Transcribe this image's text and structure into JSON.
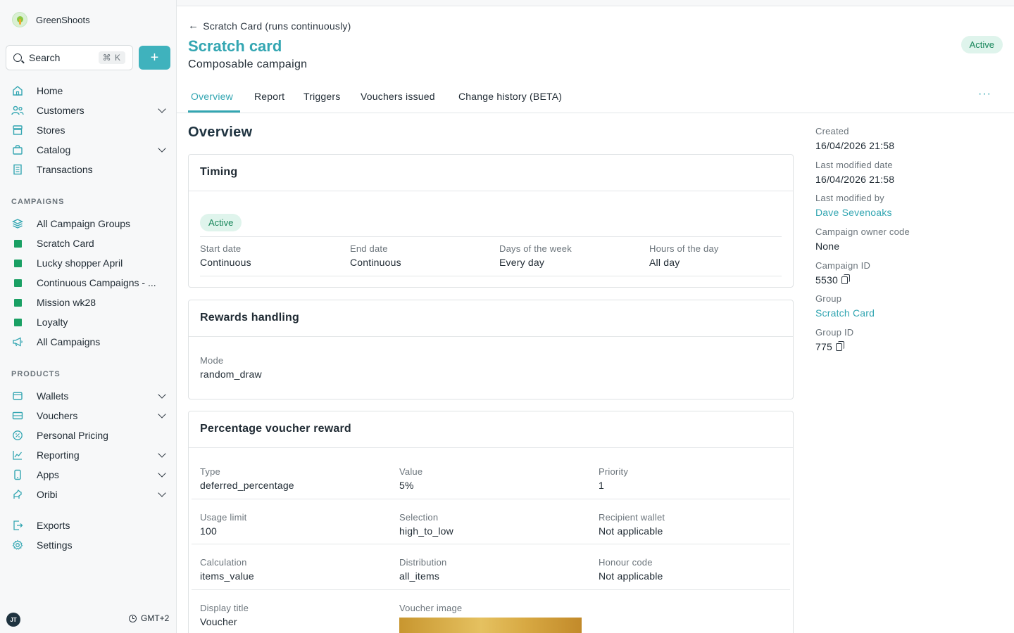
{
  "brand": {
    "name": "GreenShoots"
  },
  "search": {
    "label": "Search",
    "shortcut": "⌘ K"
  },
  "nav": {
    "home": "Home",
    "customers": "Customers",
    "stores": "Stores",
    "catalog": "Catalog",
    "transactions": "Transactions"
  },
  "campaigns_section": {
    "title": "CAMPAIGNS",
    "items": [
      "All Campaign Groups",
      "Scratch Card",
      "Lucky shopper April",
      "Continuous Campaigns - ...",
      "Mission wk28",
      "Loyalty",
      "All Campaigns"
    ]
  },
  "products_section": {
    "title": "PRODUCTS",
    "items": [
      "Wallets",
      "Vouchers",
      "Personal Pricing",
      "Reporting",
      "Apps",
      "Oribi"
    ]
  },
  "bottom_nav": {
    "exports": "Exports",
    "settings": "Settings"
  },
  "footer": {
    "avatar_initials": "JT",
    "timezone": "GMT+2"
  },
  "header": {
    "back_label": "Scratch Card (runs continuously)",
    "title": "Scratch card",
    "subtitle": "Composable campaign",
    "status": "Active"
  },
  "tabs": [
    "Overview",
    "Report",
    "Triggers",
    "Vouchers issued",
    "Change history (BETA)"
  ],
  "more_label": "···",
  "overview": {
    "title": "Overview",
    "timing": {
      "title": "Timing",
      "status": "Active",
      "fields": [
        {
          "label": "Start date",
          "value": "Continuous"
        },
        {
          "label": "End date",
          "value": "Continuous"
        },
        {
          "label": "Days of the week",
          "value": "Every day"
        },
        {
          "label": "Hours of the day",
          "value": "All day"
        }
      ]
    },
    "rewards": {
      "title": "Rewards handling",
      "mode_label": "Mode",
      "mode_value": "random_draw"
    },
    "voucher_reward": {
      "title": "Percentage voucher reward",
      "rows": [
        [
          {
            "label": "Type",
            "value": "deferred_percentage"
          },
          {
            "label": "Value",
            "value": "5%"
          },
          {
            "label": "Priority",
            "value": "1"
          }
        ],
        [
          {
            "label": "Usage limit",
            "value": "100"
          },
          {
            "label": "Selection",
            "value": "high_to_low"
          },
          {
            "label": "Recipient wallet",
            "value": "Not applicable"
          }
        ],
        [
          {
            "label": "Calculation",
            "value": "items_value"
          },
          {
            "label": "Distribution",
            "value": "all_items"
          },
          {
            "label": "Honour code",
            "value": "Not applicable"
          }
        ]
      ],
      "display_title_label": "Display title",
      "display_title_value": "Voucher",
      "voucher_image_label": "Voucher image"
    }
  },
  "meta": {
    "created_label": "Created",
    "created_value": "16/04/2026 21:58",
    "modified_label": "Last modified date",
    "modified_value": "16/04/2026 21:58",
    "modified_by_label": "Last modified by",
    "modified_by_value": "Dave Sevenoaks",
    "owner_label": "Campaign owner code",
    "owner_value": "None",
    "campaign_id_label": "Campaign ID",
    "campaign_id_value": "5530",
    "group_label": "Group",
    "group_value": "Scratch Card",
    "group_id_label": "Group ID",
    "group_id_value": "775"
  },
  "colors": {
    "accent": "#33a6b2",
    "active_bg": "#dff4ec",
    "active_text": "#17865a",
    "campaign_square": "#1aa064"
  }
}
